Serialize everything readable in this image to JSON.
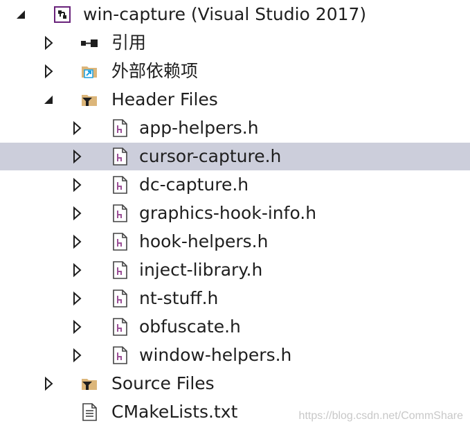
{
  "tree": {
    "project": {
      "label": "win-capture (Visual Studio 2017)"
    },
    "references": {
      "label": "引用"
    },
    "external_deps": {
      "label": "外部依赖项"
    },
    "header_files": {
      "label": "Header Files",
      "files": [
        "app-helpers.h",
        "cursor-capture.h",
        "dc-capture.h",
        "graphics-hook-info.h",
        "hook-helpers.h",
        "inject-library.h",
        "nt-stuff.h",
        "obfuscate.h",
        "window-helpers.h"
      ]
    },
    "source_files": {
      "label": "Source Files"
    },
    "cmakelists": {
      "label": "CMakeLists.txt"
    }
  },
  "selected_item": "cursor-capture.h",
  "colors": {
    "selection": "#cccedb",
    "arrow": "#1e1e1e",
    "folder": "#dcb67a",
    "project_icon": "#68217a",
    "header_icon": "#9b4f96"
  },
  "watermark": "https://blog.csdn.net/CommShare"
}
